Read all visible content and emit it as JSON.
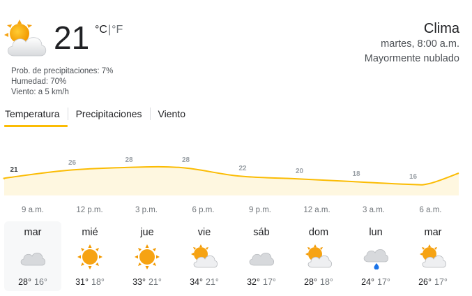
{
  "current": {
    "temp": "21",
    "icon": "partly-cloudy-icon",
    "unit_c": "°C",
    "unit_sep": "|",
    "unit_f": "°F",
    "precip": "Prob. de precipitaciones: 7%",
    "humidity": "Humedad: 70%",
    "wind": "Viento: a 5 km/h"
  },
  "header": {
    "title": "Clima",
    "datetime": "martes, 8:00 a.m.",
    "condition": "Mayormente nublado"
  },
  "tabs": [
    {
      "label": "Temperatura",
      "active": true
    },
    {
      "label": "Precipitaciones",
      "active": false
    },
    {
      "label": "Viento",
      "active": false
    }
  ],
  "chart_data": {
    "type": "area",
    "x": [
      "9 a.m.",
      "12 p.m.",
      "3 p.m.",
      "6 p.m.",
      "9 p.m.",
      "12 a.m.",
      "3 a.m.",
      "6 a.m."
    ],
    "tick_labels": [
      "9 a.m.",
      "12 p.m.",
      "3 p.m.",
      "6 p.m.",
      "9 p.m.",
      "12 a.m.",
      "3 a.m.",
      "6 a.m."
    ],
    "series": [
      {
        "values": [
          21,
          26,
          28,
          28,
          22,
          20,
          18,
          16
        ]
      }
    ],
    "data_labels": [
      "21",
      "26",
      "28",
      "28",
      "22",
      "20",
      "18",
      "16"
    ],
    "line_color": "#fbbc04",
    "fill_color": "#fef7e0",
    "grid": false
  },
  "days": [
    {
      "name": "mar",
      "icon": "cloudy-icon",
      "hi": "28°",
      "lo": "16°",
      "selected": true
    },
    {
      "name": "mié",
      "icon": "sunny-icon",
      "hi": "31°",
      "lo": "18°",
      "selected": false
    },
    {
      "name": "jue",
      "icon": "sunny-icon",
      "hi": "33°",
      "lo": "21°",
      "selected": false
    },
    {
      "name": "vie",
      "icon": "partly-cloudy-icon",
      "hi": "34°",
      "lo": "21°",
      "selected": false
    },
    {
      "name": "sáb",
      "icon": "cloudy-icon",
      "hi": "32°",
      "lo": "17°",
      "selected": false
    },
    {
      "name": "dom",
      "icon": "partly-cloudy-icon",
      "hi": "28°",
      "lo": "18°",
      "selected": false
    },
    {
      "name": "lun",
      "icon": "rain-cloud-icon",
      "hi": "24°",
      "lo": "17°",
      "selected": false
    },
    {
      "name": "mar",
      "icon": "partly-cloudy-icon",
      "hi": "26°",
      "lo": "17°",
      "selected": false
    }
  ]
}
